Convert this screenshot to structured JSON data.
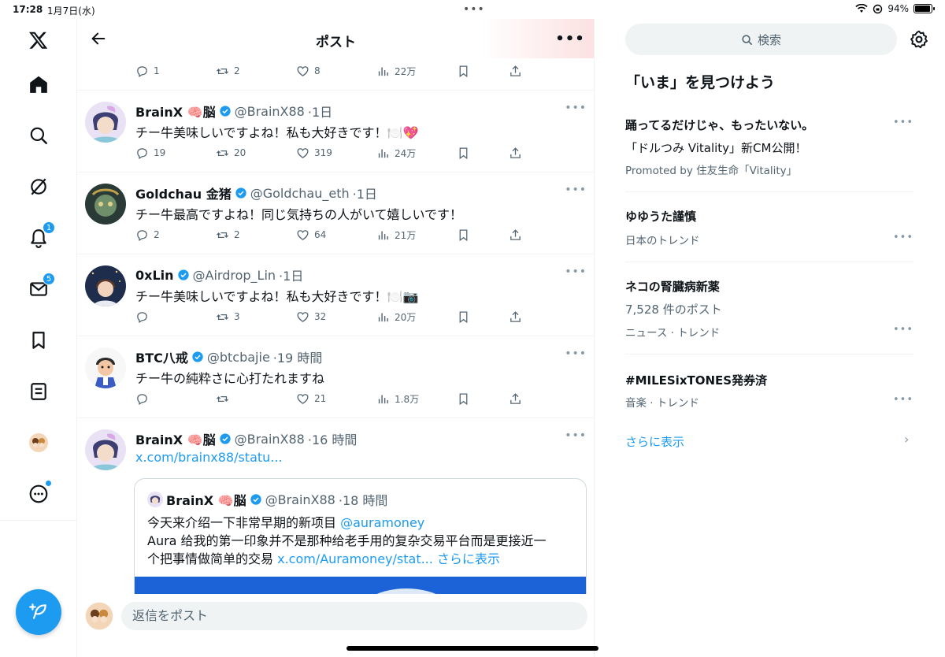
{
  "status_bar": {
    "time": "17:28",
    "date": "1月7日(水)",
    "battery_text": "94%",
    "battery_level": 0.94
  },
  "header": {
    "title": "ポスト"
  },
  "top_actions": {
    "replies": "1",
    "reposts": "2",
    "likes": "8",
    "views": "22万"
  },
  "posts": [
    {
      "name": "BrainX 🧠脳",
      "handle": "@BrainX88",
      "time": "·1日",
      "text": "チー牛美味しいですよね！私も大好きです！🍽️💖",
      "replies": "19",
      "reposts": "20",
      "likes": "319",
      "views": "24万"
    },
    {
      "name": "Goldchau 金猪",
      "handle": "@Goldchau_eth",
      "time": "·1日",
      "text": "チー牛最高ですよね！同じ気持ちの人がいて嬉しいです！",
      "replies": "2",
      "reposts": "2",
      "likes": "64",
      "views": "21万"
    },
    {
      "name": "0xLin",
      "handle": "@Airdrop_Lin",
      "time": "·1日",
      "text": "チー牛美味しいですよね！私も大好きです！🍽️📷",
      "replies": "",
      "reposts": "3",
      "likes": "32",
      "views": "20万"
    },
    {
      "name": "BTC八戒",
      "handle": "@btcbajie",
      "time": "·19 時間",
      "text": "チー牛の純粋さに心打たれますね",
      "replies": "",
      "reposts": "",
      "likes": "21",
      "views": "1.8万"
    },
    {
      "name": "BrainX 🧠脳",
      "handle": "@BrainX88",
      "time": "·16 時間",
      "link": "x.com/brainx88/statu..."
    }
  ],
  "quote": {
    "name": "BrainX 🧠脳",
    "handle": "@BrainX88",
    "time": "·18 時間",
    "line1_text": "今天来介绍一下非常早期的新项目 ",
    "line1_mention": "@auramoney",
    "line2": "Aura 给我的第一印象并不是那种给老手用的复杂交易平台而是更接近一",
    "line3_text": "个把事情做简单的交易 ",
    "line3_link": "x.com/Auramoney/stat...",
    "line3_more": " さらに表示"
  },
  "reply": {
    "placeholder": "返信をポスト"
  },
  "nav": {
    "notifications_badge": "1",
    "messages_badge": "5"
  },
  "right": {
    "search_placeholder": "検索",
    "section_title": "「いま」を見つけよう",
    "trends": [
      {
        "line1": "踊ってるだけじゃ、もったいない。",
        "line2": "「ドルつみ Vitality」新CM公開！",
        "line3": "Promoted by 住友生命「Vitality」"
      },
      {
        "line1": "ゆゆうた謹慎",
        "line3": "日本のトレンド"
      },
      {
        "line1": "ネコの腎臓病新薬",
        "line2": "7,528 件のポスト",
        "line3": "ニュース · トレンド"
      },
      {
        "line1": "#MILESixTONES発券済",
        "line3": "音楽 · トレンド"
      }
    ],
    "show_more": "さらに表示"
  },
  "colors": {
    "accent": "#1d9bf0",
    "text": "#0f1419",
    "muted": "#536471",
    "border": "#eff3f4"
  }
}
